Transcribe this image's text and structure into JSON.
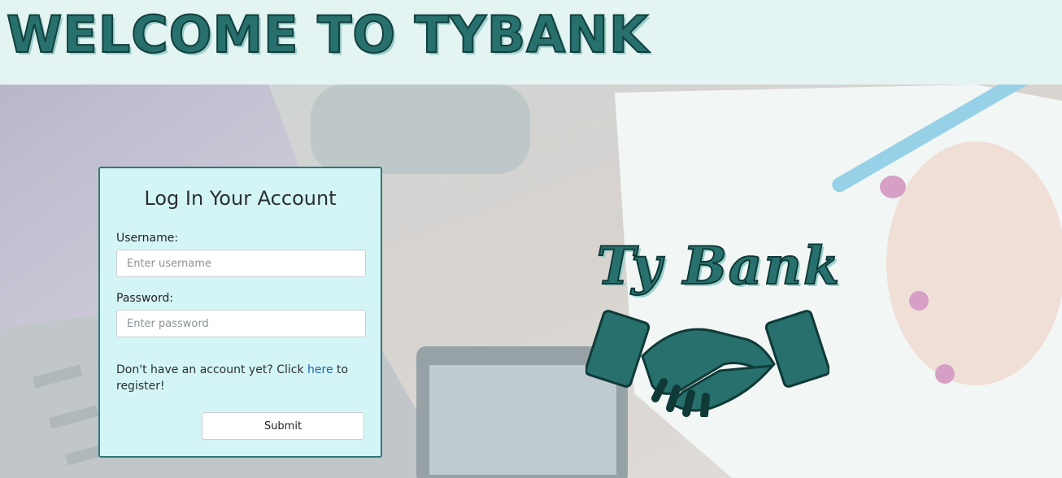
{
  "header": {
    "title": "WELCOME TO TYBANK"
  },
  "login": {
    "title": "Log In Your Account",
    "username_label": "Username:",
    "username_placeholder": "Enter username",
    "password_label": "Password:",
    "password_placeholder": "Enter password",
    "register_prefix": "Don't have an account yet? Click ",
    "register_link": "here",
    "register_suffix": " to register!",
    "submit_label": "Submit"
  },
  "logo": {
    "text": "Ty Bank",
    "icon": "handshake-icon"
  },
  "colors": {
    "accent": "#27706d",
    "card_bg": "#d4f5f6",
    "header_bg": "#e3f4f2",
    "link": "#1d63b8"
  }
}
